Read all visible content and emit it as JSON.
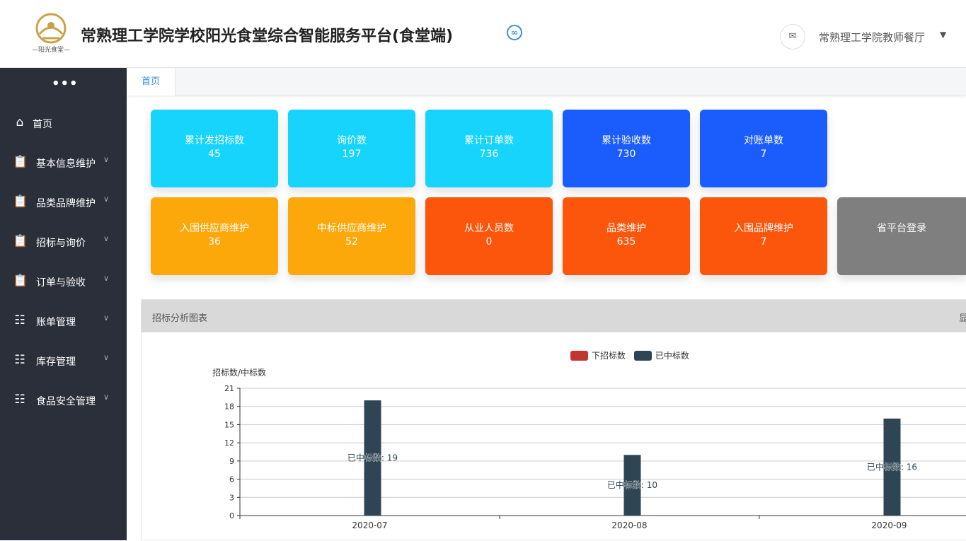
{
  "header": {
    "logo_text": "—阳光食堂—",
    "title": "常熟理工学院学校阳光食堂综合智能服务平台(食堂端)",
    "user": "常熟理工学院教师餐厅"
  },
  "sidebar": {
    "items": [
      {
        "label": "首页",
        "icon": "home-icon"
      },
      {
        "label": "基本信息维护",
        "icon": "clipboard-icon"
      },
      {
        "label": "品类品牌维护",
        "icon": "clipboard-icon"
      },
      {
        "label": "招标与询价",
        "icon": "clipboard-icon"
      },
      {
        "label": "订单与验收",
        "icon": "clipboard-icon"
      },
      {
        "label": "账单管理",
        "icon": "ledger-icon"
      },
      {
        "label": "库存管理",
        "icon": "ledger-icon"
      },
      {
        "label": "食品安全管理",
        "icon": "ledger-icon"
      }
    ]
  },
  "tabs": {
    "home": "首页"
  },
  "cards": [
    {
      "title": "累计发招标数",
      "value": "45",
      "color": "#16d4fb"
    },
    {
      "title": "询价数",
      "value": "197",
      "color": "#16d4fb"
    },
    {
      "title": "累计订单数",
      "value": "736",
      "color": "#16d4fb"
    },
    {
      "title": "累计验收数",
      "value": "730",
      "color": "#1b5cfc"
    },
    {
      "title": "对账单数",
      "value": "7",
      "color": "#1b5cfc"
    },
    {
      "title": "入围供应商维护",
      "value": "36",
      "color": "#fca80a"
    },
    {
      "title": "中标供应商维护",
      "value": "52",
      "color": "#fca80a"
    },
    {
      "title": "从业人员数",
      "value": "0",
      "color": "#fb560c"
    },
    {
      "title": "品类维护",
      "value": "635",
      "color": "#fb560c"
    },
    {
      "title": "入围品牌维护",
      "value": "7",
      "color": "#fb560c"
    },
    {
      "title": "省平台登录",
      "value": "",
      "color": "#7f7f7f"
    }
  ],
  "panel": {
    "title": "招标分析图表",
    "more": "显"
  },
  "chart_data": {
    "type": "bar",
    "ylabel": "招标数/中标数",
    "categories": [
      "2020-07",
      "2020-08",
      "2020-09"
    ],
    "ylim": [
      0,
      21
    ],
    "yticks": [
      0,
      3,
      6,
      9,
      12,
      15,
      18,
      21
    ],
    "grid": true,
    "legend_position": "top",
    "series": [
      {
        "name": "下招标数",
        "color": "#c23531",
        "values": [
          0,
          0,
          0
        ]
      },
      {
        "name": "已中标数",
        "color": "#2f4554",
        "values": [
          19,
          10,
          16
        ]
      }
    ],
    "data_labels": [
      "已中标数: 19",
      "已中标数: 10",
      "已中标数: 16"
    ]
  }
}
